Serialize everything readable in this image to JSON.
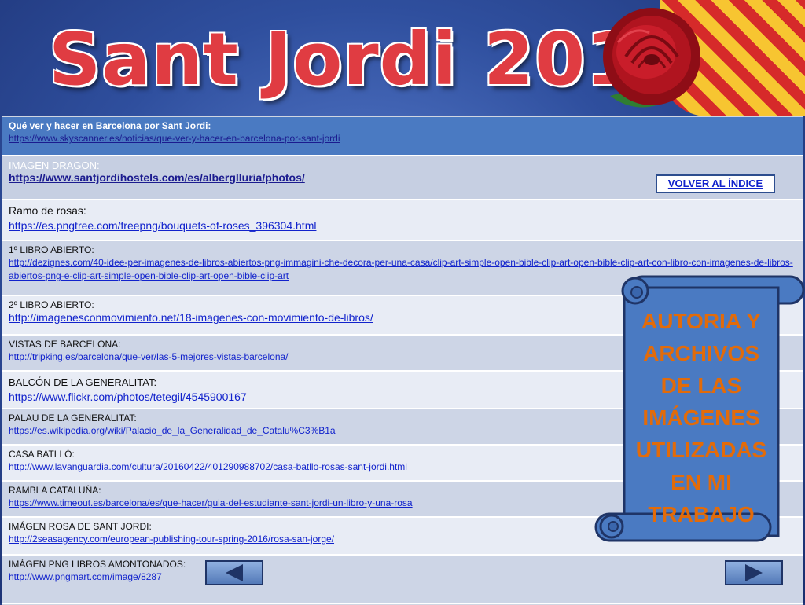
{
  "title": "Sant Jordi 2018",
  "rows": [
    {
      "label": "Qué ver y hacer en Barcelona por Sant Jordi:",
      "url": "https://www.skyscanner.es/noticias/que-ver-y-hacer-en-barcelona-por-sant-jordi"
    },
    {
      "label": "IMAGEN DRAGON:",
      "url": "https://www.santjordihostels.com/es/alberglluria/photos/"
    },
    {
      "label": "Ramo de rosas:",
      "url": "https://es.pngtree.com/freepng/bouquets-of-roses_396304.html"
    },
    {
      "label": "1º LIBRO ABIERTO:",
      "url": "http://dezignes.com/40-idee-per-imagenes-de-libros-abiertos-png-immagini-che-decora-per-una-casa/clip-art-simple-open-bible-clip-art-open-bible-clip-art-con-libro-con-imagenes-de-libros-abiertos-png-e-clip-art-simple-open-bible-clip-art-open-bible-clip-art"
    },
    {
      "label": "2º LIBRO ABIERTO:",
      "url": "http://imagenesconmovimiento.net/18-imagenes-con-movimiento-de-libros/"
    },
    {
      "label": "VISTAS DE BARCELONA:",
      "url": "http://tripking.es/barcelona/que-ver/las-5-mejores-vistas-barcelona/"
    },
    {
      "label": "BALCÓN DE LA GENERALITAT:",
      "url": "https://www.flickr.com/photos/tetegil/4545900167"
    },
    {
      "label": "PALAU DE LA GENERALITAT:",
      "url": "https://es.wikipedia.org/wiki/Palacio_de_la_Generalidad_de_Catalu%C3%B1a"
    },
    {
      "label": "CASA BATLLÓ:",
      "url": "http://www.lavanguardia.com/cultura/20160422/401290988702/casa-batllo-rosas-sant-jordi.html"
    },
    {
      "label": "RAMBLA CATALUÑA:",
      "url": "https://www.timeout.es/barcelona/es/que-hacer/guia-del-estudiante-sant-jordi-un-libro-y-una-rosa"
    },
    {
      "label": "IMÁGEN ROSA DE SANT JORDI:",
      "url": "http://2seasagency.com/european-publishing-tour-spring-2016/rosa-san-jorge/"
    },
    {
      "label": "IMÁGEN PNG LIBROS AMONTONADOS:",
      "url": "http://www.pngmart.com/image/8287"
    }
  ],
  "volver_button": "VOLVER AL ÍNDICE",
  "scroll_banner": [
    "AUTORIA Y",
    "ARCHIVOS",
    "DE LAS",
    "IMÁGENES",
    "UTILIZADAS",
    "EN MI",
    "TRABAJO"
  ],
  "icons": {
    "prev": "left-arrow-icon",
    "next": "right-arrow-icon"
  },
  "colors": {
    "title": "#e03c42",
    "banner_text": "#e26b0a",
    "header_row": "#4a7ac2",
    "link": "#1122cc"
  }
}
